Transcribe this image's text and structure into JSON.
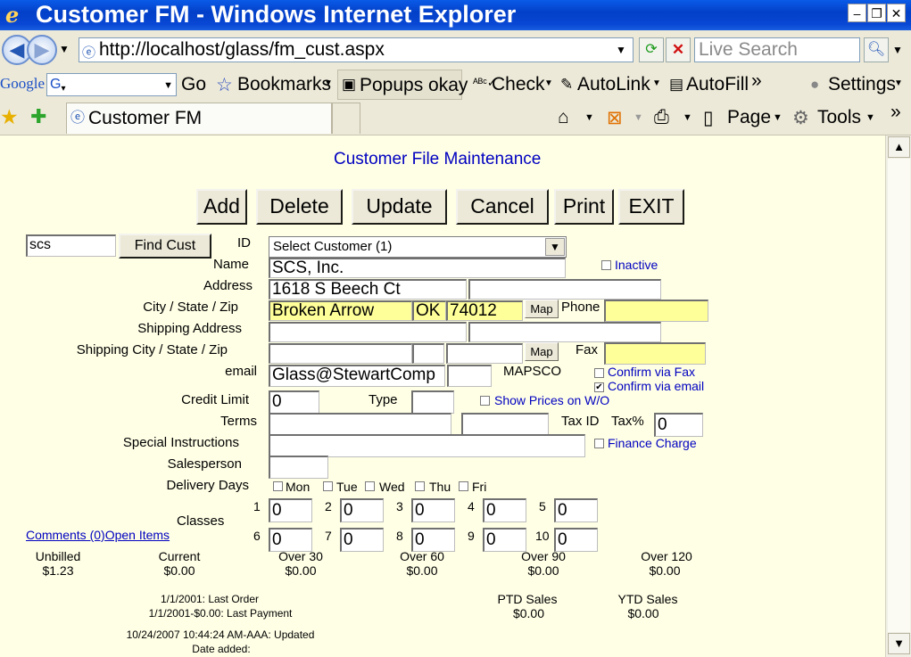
{
  "window": {
    "title": "Customer FM - Windows Internet Explorer",
    "url": "http://localhost/glass/fm_cust.aspx",
    "search_placeholder": "Live Search",
    "tab_title": "Customer FM"
  },
  "google_bar": {
    "logo": "Google",
    "go": "Go",
    "bookmarks": "Bookmarks",
    "popups": "Popups okay",
    "check": "Check",
    "autolink": "AutoLink",
    "autofill": "AutoFill",
    "more": "»",
    "settings": "Settings"
  },
  "command_bar": {
    "page": "Page",
    "tools": "Tools",
    "more": "»"
  },
  "form": {
    "heading": "Customer File Maintenance",
    "buttons": {
      "add": "Add",
      "delete": "Delete",
      "update": "Update",
      "cancel": "Cancel",
      "print": "Print",
      "exit": "EXIT"
    },
    "find_value": "scs",
    "find_button": "Find Cust",
    "id_label": "ID",
    "customer_select": "Select Customer (1)",
    "name_label": "Name",
    "name_value": "SCS, Inc.",
    "inactive_label": "Inactive",
    "address_label": "Address",
    "address_value": "1618 S Beech Ct",
    "address2_value": "",
    "csz_label": "City / State / Zip",
    "city_value": "Broken Arrow",
    "state_value": "OK",
    "zip_value": "74012",
    "map_label": "Map",
    "phone_label": "Phone",
    "phone_value": "",
    "ship_addr_label": "Shipping Address",
    "ship_csz_label": "Shipping City / State / Zip",
    "fax_label": "Fax",
    "email_label": "email",
    "email_value": "Glass@StewartComp",
    "mapsco_label": "MAPSCO",
    "confirm_fax_label": "Confirm via Fax",
    "confirm_email_label": "Confirm via email",
    "credit_label": "Credit Limit",
    "credit_value": "0",
    "type_label": "Type",
    "show_prices_label": "Show Prices on W/O",
    "terms_label": "Terms",
    "taxid_label": "Tax ID",
    "taxpct_label": "Tax%",
    "taxpct_value": "0",
    "special_label": "Special Instructions",
    "finance_label": "Finance Charge",
    "salesperson_label": "Salesperson",
    "delivery_label": "Delivery Days",
    "days": [
      "Mon",
      "Tue",
      "Wed",
      "Thu",
      "Fri"
    ],
    "classes_label": "Classes",
    "class_nums": [
      "1",
      "2",
      "3",
      "4",
      "5",
      "6",
      "7",
      "8",
      "9",
      "10"
    ],
    "class_values": [
      "0",
      "0",
      "0",
      "0",
      "0",
      "0",
      "0",
      "0",
      "0",
      "0"
    ],
    "comments_link": "Comments (0)",
    "open_items_link": "Open Items"
  },
  "summary": {
    "unbilled_label": "Unbilled",
    "unbilled_value": "$1.23",
    "current_label": "Current",
    "current_value": "$0.00",
    "over30_label": "Over 30",
    "over30_value": "$0.00",
    "over60_label": "Over 60",
    "over60_value": "$0.00",
    "over90_label": "Over 90",
    "over90_value": "$0.00",
    "over120_label": "Over 120",
    "over120_value": "$0.00",
    "last_order": "1/1/2001: Last Order",
    "last_payment": "1/1/2001-$0.00: Last Payment",
    "ptd_label": "PTD Sales",
    "ptd_value": "$0.00",
    "ytd_label": "YTD Sales",
    "ytd_value": "$0.00",
    "updated": "10/24/2007 10:44:24 AM-AAA: Updated",
    "date_added": "Date added:"
  }
}
